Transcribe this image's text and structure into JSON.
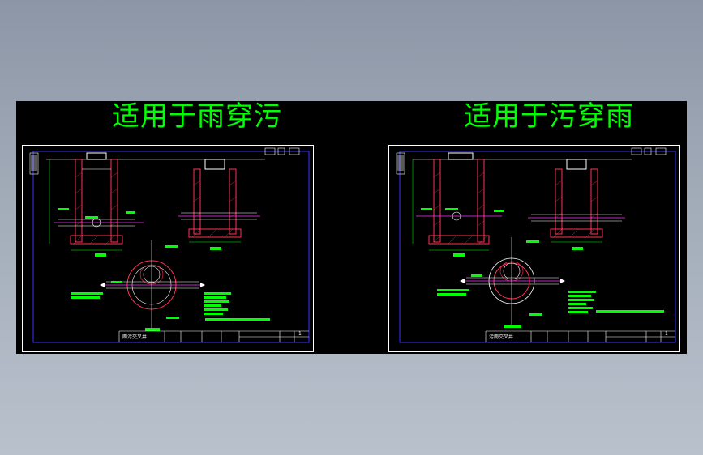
{
  "viewer": {
    "left_title": "适用于雨穿污",
    "right_title": "适用于污穿雨"
  },
  "colors": {
    "background": "#000000",
    "heading": "#00ff00",
    "wall": "#ff3355",
    "frame": "#3333ff",
    "annotation": "#00ff00",
    "line": "#ffffff",
    "pipe_center": "#ff33ff"
  },
  "sheets": [
    {
      "title_block": {
        "name": "雨污交叉井",
        "sheet_no": "1"
      }
    },
    {
      "title_block": {
        "name": "污雨交叉井",
        "sheet_no": "1"
      }
    }
  ]
}
